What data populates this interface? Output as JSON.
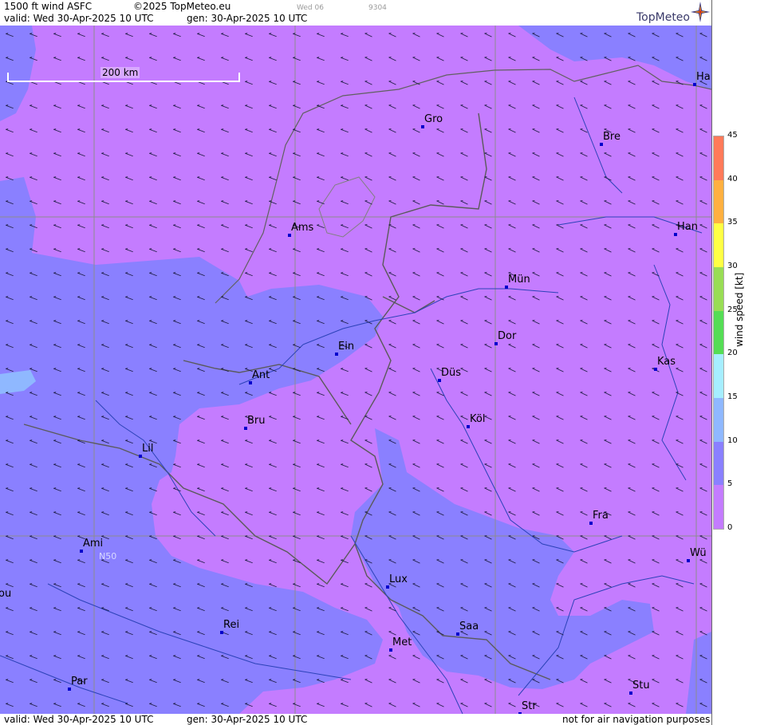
{
  "header": {
    "product": "1500 ft wind ASFC",
    "copyright": "©2025 TopMeteo.eu",
    "day_tag": "Wed 06",
    "code": "9304",
    "valid": "valid:  Wed  30-Apr-2025  10 UTC",
    "generated": "gen: 30-Apr-2025 10 UTC"
  },
  "footer": {
    "valid": "valid:  Wed  30-Apr-2025  10 UTC",
    "generated": "gen: 30-Apr-2025 10 UTC",
    "disclaimer": "not for air navigation purposes"
  },
  "brand": {
    "logo": "TopMeteo",
    "icon": "compass-star-icon"
  },
  "scale": {
    "label": "200 km"
  },
  "graticule": {
    "lat_label": "N50"
  },
  "legend": {
    "title": "wind  speed  [kt]",
    "ticks": [
      "0",
      "5",
      "10",
      "15",
      "20",
      "25",
      "30",
      "35",
      "40",
      "45"
    ],
    "colors": {
      "0-5": "#c47cff",
      "5-10": "#8a80ff",
      "10-15": "#8fb8ff",
      "15-20": "#a6eeff",
      "20-25": "#55dd55",
      "25-30": "#99dd55",
      "30-35": "#ffff44",
      "35-40": "#ffb040",
      "40-45": "#ff7a5a"
    }
  },
  "cities": [
    {
      "name": "Gro"
    },
    {
      "name": "Bre"
    },
    {
      "name": "Ha"
    },
    {
      "name": "Ams"
    },
    {
      "name": "Han"
    },
    {
      "name": "Mün"
    },
    {
      "name": "Dor"
    },
    {
      "name": "Ein"
    },
    {
      "name": "Kas"
    },
    {
      "name": "Ant"
    },
    {
      "name": "Düs"
    },
    {
      "name": "Bru"
    },
    {
      "name": "Köl"
    },
    {
      "name": "Lil"
    },
    {
      "name": "Fra"
    },
    {
      "name": "Ami"
    },
    {
      "name": "Wü"
    },
    {
      "name": "Lux"
    },
    {
      "name": "ou"
    },
    {
      "name": "Rei"
    },
    {
      "name": "Saa"
    },
    {
      "name": "Met"
    },
    {
      "name": "Par"
    },
    {
      "name": "Stu"
    },
    {
      "name": "Str"
    }
  ]
}
